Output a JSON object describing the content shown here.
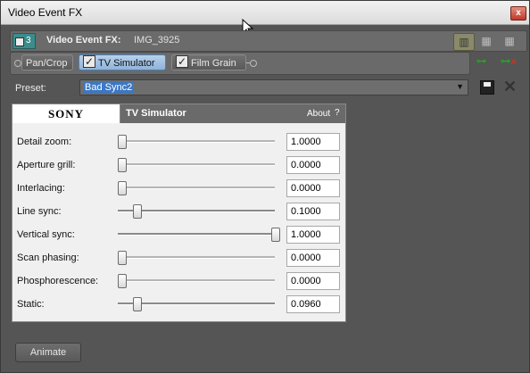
{
  "window": {
    "title": "Video Event FX",
    "close_glyph": "x"
  },
  "header": {
    "track_number": "3",
    "label": "Video Event FX:",
    "value": "IMG_3925",
    "view_buttons": [
      {
        "icon": "single-panel-icon",
        "glyph": "▥"
      },
      {
        "icon": "grid-icon",
        "glyph": "▦"
      },
      {
        "icon": "grid-wide-icon",
        "glyph": "▦"
      }
    ]
  },
  "chain": {
    "plugins": [
      {
        "label": "Pan/Crop",
        "checked": false,
        "selected": false
      },
      {
        "label": "TV Simulator",
        "checked": true,
        "selected": true
      },
      {
        "label": "Film Grain",
        "checked": true,
        "selected": false
      }
    ]
  },
  "preset": {
    "label": "Preset:",
    "value": "Bad Sync2"
  },
  "panel": {
    "brand": "SONY",
    "title": "TV Simulator",
    "about": "About",
    "help": "?",
    "rows": [
      {
        "label": "Detail zoom:",
        "value": "1.0000",
        "level": 0.0
      },
      {
        "label": "Aperture grill:",
        "value": "0.0000",
        "level": 0.0
      },
      {
        "label": "Interlacing:",
        "value": "0.0000",
        "level": 0.0
      },
      {
        "label": "Line sync:",
        "value": "0.1000",
        "level": 0.1
      },
      {
        "label": "Vertical sync:",
        "value": "1.0000",
        "level": 1.0
      },
      {
        "label": "Scan phasing:",
        "value": "0.0000",
        "level": 0.0
      },
      {
        "label": "Phosphorescence:",
        "value": "0.0000",
        "level": 0.0
      },
      {
        "label": "Static:",
        "value": "0.0960",
        "level": 0.096
      }
    ]
  },
  "footer": {
    "animate_label": "Animate"
  }
}
